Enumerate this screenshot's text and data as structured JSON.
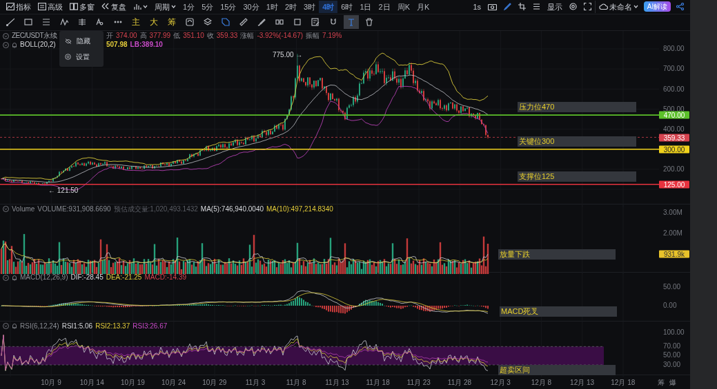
{
  "menu_bar": [
    {
      "label": "指标"
    },
    {
      "label": "高级"
    },
    {
      "label": "多窗"
    },
    {
      "label": "复盘"
    }
  ],
  "period_label": "周期",
  "intervals": [
    {
      "label": "1分",
      "selected": false
    },
    {
      "label": "5分",
      "selected": false
    },
    {
      "label": "15分",
      "selected": false
    },
    {
      "label": "30分",
      "selected": false
    },
    {
      "label": "1时",
      "selected": false
    },
    {
      "label": "2时",
      "selected": false
    },
    {
      "label": "3时",
      "selected": false
    },
    {
      "label": "4时",
      "selected": true
    },
    {
      "label": "6时",
      "selected": false
    },
    {
      "label": "1日",
      "selected": false
    },
    {
      "label": "2日",
      "selected": false
    },
    {
      "label": "周K",
      "selected": false
    },
    {
      "label": "月K",
      "selected": false
    }
  ],
  "right_toolbar": {
    "refresh_rate": "1s",
    "display_label": "显示",
    "layout_name": "未命名",
    "ai_button": "AI解读"
  },
  "drawing_toolbar": [
    {
      "kind": "icon",
      "selected": false
    },
    {
      "kind": "icon",
      "selected": false
    },
    {
      "kind": "icon",
      "selected": false
    },
    {
      "kind": "icon",
      "selected": false
    },
    {
      "kind": "icon",
      "selected": false
    },
    {
      "kind": "icon",
      "selected": false
    },
    {
      "kind": "icon",
      "selected": false
    },
    {
      "kind": "text",
      "label": "主"
    },
    {
      "kind": "text",
      "label": "大"
    },
    {
      "kind": "text",
      "label": "筹"
    },
    {
      "kind": "icon",
      "selected": false
    },
    {
      "kind": "icon",
      "selected": false
    },
    {
      "kind": "icon",
      "selected": false
    },
    {
      "kind": "icon",
      "selected": false
    },
    {
      "kind": "icon",
      "selected": false
    },
    {
      "kind": "icon",
      "selected": false
    },
    {
      "kind": "icon",
      "selected": false
    },
    {
      "kind": "icon",
      "selected": false
    },
    {
      "kind": "icon",
      "selected": false
    },
    {
      "kind": "icon",
      "selected": true
    },
    {
      "kind": "icon",
      "selected": false
    }
  ],
  "price_pane": {
    "symbol": "ZEC/USDT永续",
    "ohlc": [
      {
        "label": "开",
        "value": "374.00"
      },
      {
        "label": "高",
        "value": "377.99"
      },
      {
        "label": "低",
        "value": "351.10"
      },
      {
        "label": "收",
        "value": "359.33"
      },
      {
        "label": "涨幅",
        "value": "-3.92%(-14.67)"
      },
      {
        "label": "振幅",
        "value": "7.19%"
      }
    ],
    "indicator": "BOLL(20,2)",
    "indicator_values": [
      {
        "text": "507.98",
        "color": "#e3cc3a"
      },
      {
        "text": "LB:389.10",
        "color": "#c84bc8"
      }
    ],
    "context_menu": [
      {
        "label": "隐藏"
      },
      {
        "label": "设置"
      }
    ],
    "high_marker": "775.00 →",
    "low_marker": "← 121.50",
    "axis_ticks": [
      "800.00",
      "700.00",
      "600.00",
      "500.00",
      "400.00",
      "200.00"
    ],
    "levels": [
      {
        "kind": "level",
        "value": "470.00",
        "color": "#5cc12a",
        "note": "压力位470"
      },
      {
        "kind": "current",
        "value": "359.33",
        "color": "#d6434f"
      },
      {
        "kind": "level",
        "value": "300.00",
        "color": "#f0d21c",
        "note": "关键位300"
      },
      {
        "kind": "level",
        "value": "125.00",
        "color": "#e8323e",
        "note": "支撑位125"
      }
    ]
  },
  "volume_pane": {
    "title": "Volume",
    "values": [
      {
        "text": "VOLUME:931,908.6690",
        "color": "#8a8d94"
      },
      {
        "text": "预估成交量:1,020,493.1432",
        "color": "#5a5d64"
      },
      {
        "text": "MA(5):746,940.0040",
        "color": "#d8dade"
      },
      {
        "text": "MA(10):497,214.8340",
        "color": "#e3cc3a"
      }
    ],
    "axis_ticks": [
      "3.00M",
      "2.00M"
    ],
    "current_tag": "931.9k",
    "note": "放量下跌"
  },
  "macd_pane": {
    "title": "MACD(12,26,9)",
    "values": [
      {
        "text": "DIF:-28.45",
        "color": "#d8dade"
      },
      {
        "text": "DEA:-21.25",
        "color": "#e3cc3a"
      },
      {
        "text": "MACD:-14.39",
        "color": "#d6434f"
      }
    ],
    "axis_ticks": [
      "50.00",
      "0.00"
    ],
    "note": "MACD死叉"
  },
  "rsi_pane": {
    "title": "RSI(6,12,24)",
    "values": [
      {
        "text": "RSI1:5.06",
        "color": "#d8dade"
      },
      {
        "text": "RSI2:13.37",
        "color": "#e3cc3a"
      },
      {
        "text": "RSI3:26.67",
        "color": "#c84bc8"
      }
    ],
    "axis_ticks": [
      "100.00",
      "70.00",
      "50.00",
      "30.00"
    ],
    "note": "超卖区间"
  },
  "x_axis": [
    "10月 9",
    "10月 14",
    "10月 19",
    "10月 24",
    "10月 29",
    "11月 3",
    "11月 8",
    "11月 13",
    "11月 18",
    "11月 23",
    "11月 28",
    "12月 3",
    "12月 8",
    "12月 13",
    "12月 18"
  ],
  "corner_buttons": [
    "筹",
    "爆"
  ]
}
